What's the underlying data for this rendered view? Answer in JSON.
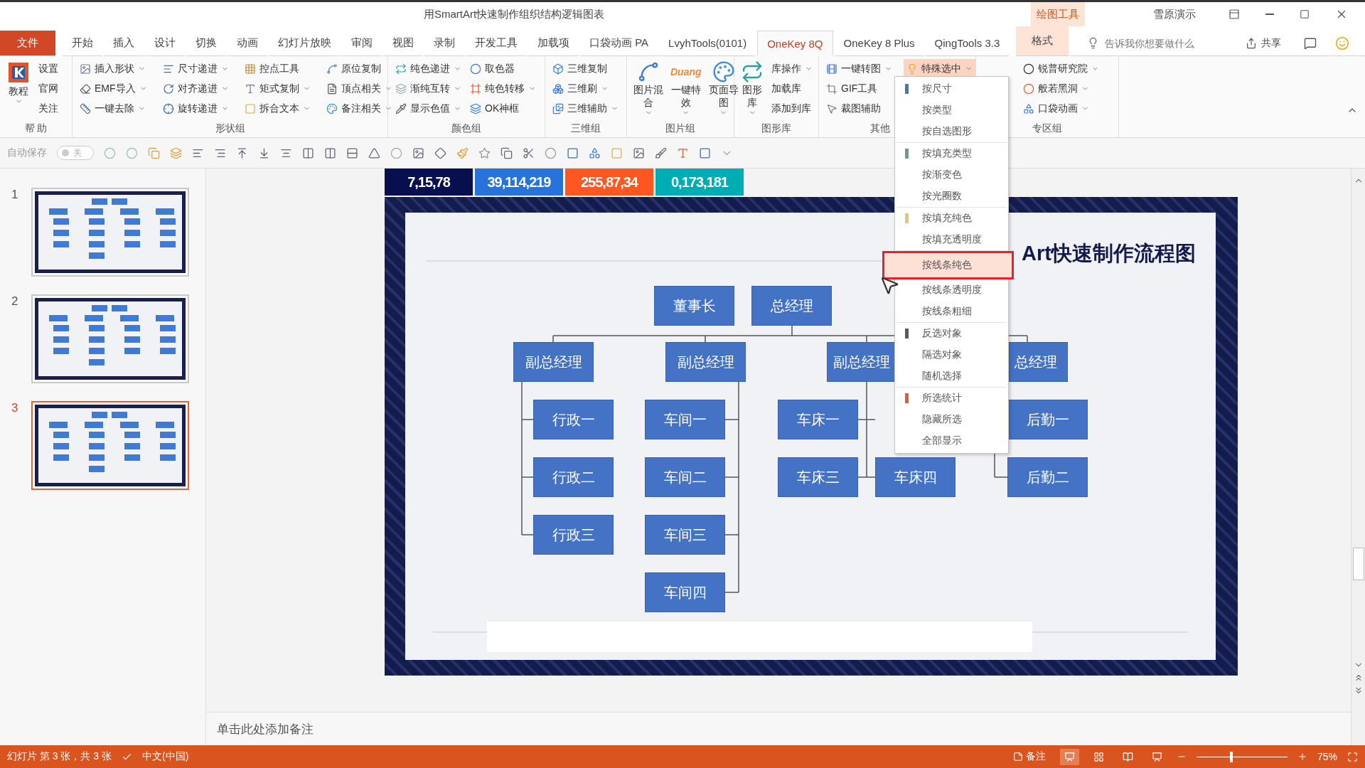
{
  "window": {
    "title": "用SmartArt快速制作组织结构逻辑图表",
    "context_header": "绘图工具",
    "account": "雪原演示"
  },
  "tabs": [
    {
      "label": "文件",
      "kind": "file",
      "selected": false
    },
    {
      "label": "开始",
      "kind": "tab",
      "selected": false
    },
    {
      "label": "插入",
      "kind": "tab",
      "selected": false
    },
    {
      "label": "设计",
      "kind": "tab",
      "selected": false
    },
    {
      "label": "切换",
      "kind": "tab",
      "selected": false
    },
    {
      "label": "动画",
      "kind": "tab",
      "selected": false
    },
    {
      "label": "幻灯片放映",
      "kind": "tab",
      "selected": false
    },
    {
      "label": "审阅",
      "kind": "tab",
      "selected": false
    },
    {
      "label": "视图",
      "kind": "tab",
      "selected": false
    },
    {
      "label": "录制",
      "kind": "tab",
      "selected": false
    },
    {
      "label": "开发工具",
      "kind": "tab",
      "selected": false
    },
    {
      "label": "加载项",
      "kind": "tab",
      "selected": false
    },
    {
      "label": "口袋动画 PA",
      "kind": "tab",
      "selected": false
    },
    {
      "label": "LvyhTools(0101)",
      "kind": "tab",
      "selected": false
    },
    {
      "label": "OneKey 8Q",
      "kind": "tab",
      "selected": true
    },
    {
      "label": "OneKey 8 Plus",
      "kind": "tab",
      "selected": false
    },
    {
      "label": "QingTools 3.3",
      "kind": "tab",
      "selected": false
    },
    {
      "label": "格式",
      "kind": "context",
      "selected": false
    }
  ],
  "tell_me": {
    "placeholder": "告诉我你想要做什么"
  },
  "share": "共享",
  "ribbon": {
    "groups": [
      {
        "label": "帮 助",
        "columns": [
          {
            "kind": "large",
            "items": [
              {
                "label": "教程",
                "dropdown": true,
                "pressed": false
              }
            ]
          },
          {
            "kind": "text",
            "items": [
              {
                "label": "设置",
                "dropdown": false,
                "pressed": false
              },
              {
                "label": "官网",
                "dropdown": false,
                "pressed": false
              },
              {
                "label": "关注",
                "dropdown": false,
                "pressed": false
              }
            ]
          }
        ]
      },
      {
        "label": "形状组",
        "columns": [
          {
            "kind": "small",
            "items": [
              {
                "label": "插入形状",
                "dropdown": true,
                "pressed": false
              },
              {
                "label": "EMF导入",
                "dropdown": true,
                "pressed": false
              },
              {
                "label": "一键去除",
                "dropdown": true,
                "pressed": false
              }
            ]
          },
          {
            "kind": "small",
            "items": [
              {
                "label": "尺寸递进",
                "dropdown": true,
                "pressed": false
              },
              {
                "label": "对齐递进",
                "dropdown": true,
                "pressed": false
              },
              {
                "label": "旋转递进",
                "dropdown": true,
                "pressed": false
              }
            ]
          },
          {
            "kind": "small",
            "items": [
              {
                "label": "控点工具",
                "dropdown": false,
                "pressed": false
              },
              {
                "label": "矩式复制",
                "dropdown": true,
                "pressed": false
              },
              {
                "label": "拆合文本",
                "dropdown": true,
                "pressed": false
              }
            ]
          },
          {
            "kind": "small",
            "items": [
              {
                "label": "原位复制",
                "dropdown": false,
                "pressed": false
              },
              {
                "label": "顶点相关",
                "dropdown": true,
                "pressed": false
              },
              {
                "label": "备注相关",
                "dropdown": true,
                "pressed": false
              }
            ]
          }
        ]
      },
      {
        "label": "颜色组",
        "columns": [
          {
            "kind": "small",
            "items": [
              {
                "label": "纯色递进",
                "dropdown": true,
                "pressed": false
              },
              {
                "label": "渐纯互转",
                "dropdown": true,
                "pressed": false
              },
              {
                "label": "显示色值",
                "dropdown": true,
                "pressed": false
              }
            ]
          },
          {
            "kind": "small",
            "items": [
              {
                "label": "取色器",
                "dropdown": false,
                "pressed": false
              },
              {
                "label": "纯色转移",
                "dropdown": true,
                "pressed": false
              },
              {
                "label": "OK神框",
                "dropdown": false,
                "pressed": false
              }
            ]
          }
        ]
      },
      {
        "label": "三维组",
        "columns": [
          {
            "kind": "small",
            "items": [
              {
                "label": "三维复制",
                "dropdown": false,
                "pressed": false
              },
              {
                "label": "三维刷",
                "dropdown": true,
                "pressed": false
              },
              {
                "label": "三维辅助",
                "dropdown": true,
                "pressed": false
              }
            ]
          }
        ]
      },
      {
        "label": "图片组",
        "columns": [
          {
            "kind": "large",
            "items": [
              {
                "label": "图片混合",
                "dropdown": true,
                "pressed": false
              }
            ]
          },
          {
            "kind": "large",
            "items": [
              {
                "label": "一键特效",
                "dropdown": true,
                "pressed": false,
                "icon_text": "Duang"
              }
            ]
          },
          {
            "kind": "large",
            "items": [
              {
                "label": "页面导图",
                "dropdown": true,
                "pressed": false
              }
            ]
          }
        ]
      },
      {
        "label": "图形库",
        "columns": [
          {
            "kind": "large",
            "items": [
              {
                "label": "图形库",
                "dropdown": true,
                "pressed": false
              }
            ]
          },
          {
            "kind": "text",
            "items": [
              {
                "label": "库操作",
                "dropdown": true,
                "pressed": false
              },
              {
                "label": "加载库",
                "dropdown": false,
                "pressed": false
              },
              {
                "label": "添加到库",
                "dropdown": false,
                "pressed": false
              }
            ]
          }
        ]
      },
      {
        "label": "其他",
        "columns": [
          {
            "kind": "small",
            "items": [
              {
                "label": "一键转图",
                "dropdown": true,
                "pressed": false
              },
              {
                "label": "GIF工具",
                "dropdown": false,
                "pressed": false
              },
              {
                "label": "裁图辅助",
                "dropdown": false,
                "pressed": false
              }
            ]
          },
          {
            "kind": "small",
            "items": [
              {
                "label": "特殊选中",
                "dropdown": true,
                "pressed": true
              }
            ]
          }
        ]
      },
      {
        "label": "专区组",
        "columns": [
          {
            "kind": "small",
            "items": [
              {
                "label": "锐普研究院",
                "dropdown": true,
                "pressed": false
              },
              {
                "label": "般若黑洞",
                "dropdown": true,
                "pressed": false
              },
              {
                "label": "口袋动画",
                "dropdown": true,
                "pressed": false
              }
            ]
          }
        ]
      }
    ]
  },
  "quick_toolbar": {
    "autosave_label": "自动保存",
    "autosave": {
      "on": false,
      "label": "关"
    }
  },
  "slides": [
    {
      "number": "1",
      "selected": false
    },
    {
      "number": "2",
      "selected": false
    },
    {
      "number": "3",
      "selected": true
    }
  ],
  "color_values": [
    {
      "text": "7,15,78",
      "color": "#070f4e"
    },
    {
      "text": "39,114,219",
      "color": "#2772db"
    },
    {
      "text": "255,87,34",
      "color": "#ff5722"
    },
    {
      "text": "0,173,181",
      "color": "#00adb5"
    }
  ],
  "slide": {
    "title": "Art快速制作流程图",
    "nodes": [
      {
        "text": "董事长"
      },
      {
        "text": "总经理"
      },
      {
        "text": "副总经理"
      },
      {
        "text": "副总经理"
      },
      {
        "text": "副总经理"
      },
      {
        "text": "总经理"
      },
      {
        "text": "行政一"
      },
      {
        "text": "行政二"
      },
      {
        "text": "行政三"
      },
      {
        "text": "车间一"
      },
      {
        "text": "车间二"
      },
      {
        "text": "车间三"
      },
      {
        "text": "车间四"
      },
      {
        "text": "车床一"
      },
      {
        "text": "车床三"
      },
      {
        "text": "车床四"
      },
      {
        "text": "后勤一"
      },
      {
        "text": "后勤二"
      }
    ]
  },
  "special_select_menu": {
    "groups": [
      {
        "color": "#4a78a8",
        "items": [
          {
            "label": "按尺寸",
            "selected": false
          },
          {
            "label": "按类型",
            "selected": false
          },
          {
            "label": "按自选图形",
            "selected": false
          }
        ]
      },
      {
        "color": "#6d9a8a",
        "items": [
          {
            "label": "按填充类型",
            "selected": false
          },
          {
            "label": "按渐变色",
            "selected": false
          },
          {
            "label": "按光圈数",
            "selected": false
          }
        ]
      },
      {
        "color": "#e8c47a",
        "items": [
          {
            "label": "按填充纯色",
            "selected": false
          },
          {
            "label": "按填充透明度",
            "selected": false
          }
        ]
      },
      {
        "items": [
          {
            "label": "按线条纯色",
            "selected": true
          },
          {
            "label": "按线条透明度",
            "selected": false
          },
          {
            "label": "按线条粗细",
            "selected": false
          }
        ]
      },
      {
        "color": "#5a5a5a",
        "items": [
          {
            "label": "反选对象",
            "selected": false
          },
          {
            "label": "隔选对象",
            "selected": false
          },
          {
            "label": "随机选择",
            "selected": false
          }
        ]
      },
      {
        "color": "#d9603a",
        "items": [
          {
            "label": "所选统计",
            "selected": false
          },
          {
            "label": "隐藏所选",
            "selected": false
          },
          {
            "label": "全部显示",
            "selected": false
          }
        ]
      }
    ]
  },
  "notes": {
    "placeholder": "单击此处添加备注"
  },
  "status_bar": {
    "slide_info": "幻灯片 第 3 张，共 3 张",
    "language": "中文(中国)",
    "notes_button": "备注",
    "zoom": {
      "level": 0.37,
      "reading": "75%"
    }
  }
}
